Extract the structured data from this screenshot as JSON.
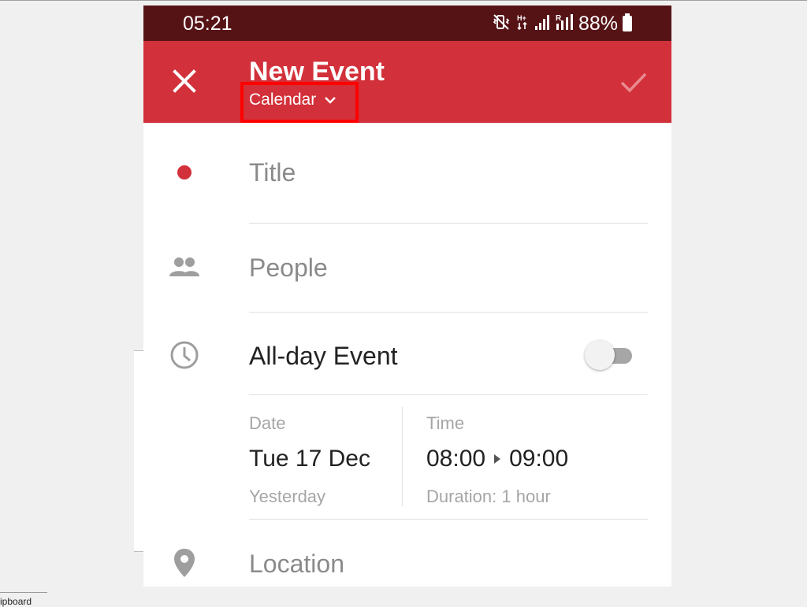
{
  "status_bar": {
    "time": "05:21",
    "battery": "88%",
    "icons": [
      "vibrate-off-icon",
      "network-type-icon",
      "signal-icon",
      "roaming-signal-icon",
      "battery-icon"
    ]
  },
  "app_bar": {
    "title": "New Event",
    "calendar_label": "Calendar",
    "close_icon": "close-icon",
    "confirm_icon": "check-icon",
    "accent_color": "#d2303a",
    "status_bar_color": "#561316",
    "highlight_color": "#ff0000"
  },
  "form": {
    "title_placeholder": "Title",
    "people_placeholder": "People",
    "all_day_label": "All-day Event",
    "all_day_enabled": false,
    "date": {
      "label": "Date",
      "value": "Tue 17 Dec",
      "relative": "Yesterday"
    },
    "time": {
      "label": "Time",
      "start": "08:00",
      "end": "09:00",
      "duration": "Duration: 1 hour"
    },
    "location_placeholder": "Location"
  },
  "taskbar": {
    "label": "ipboard"
  }
}
